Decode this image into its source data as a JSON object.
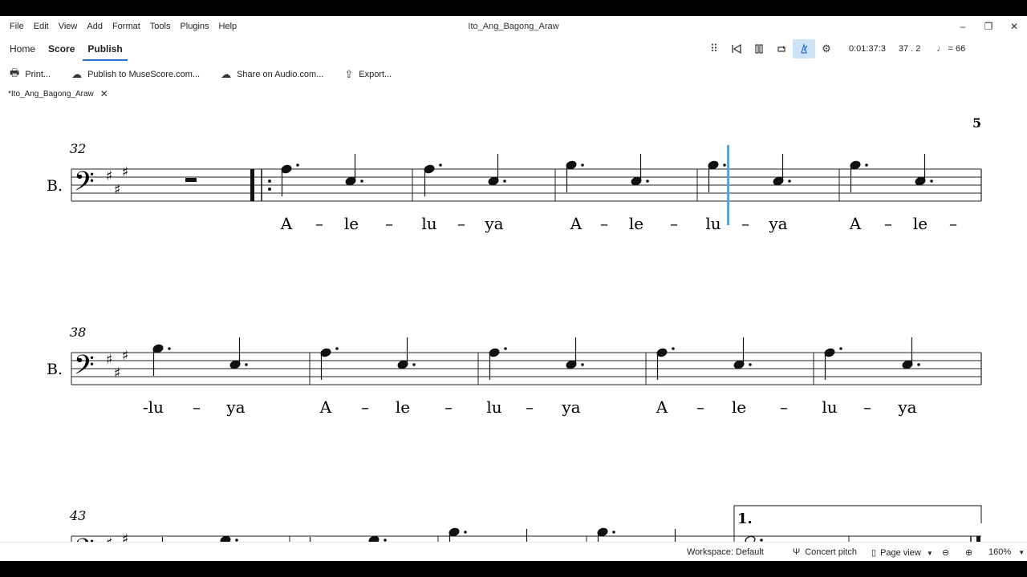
{
  "menu": [
    "File",
    "Edit",
    "View",
    "Add",
    "Format",
    "Tools",
    "Plugins",
    "Help"
  ],
  "window": {
    "title": "Ito_Ang_Bagong_Araw",
    "minimize": "–",
    "restore": "❐",
    "close": "✕"
  },
  "tabs": [
    {
      "label": "Home"
    },
    {
      "label": "Score"
    },
    {
      "label": "Publish"
    }
  ],
  "transport": {
    "time": "0:01:37:3",
    "position": "37 . 2",
    "tempo": "= 66",
    "tempo_note": "♩"
  },
  "toolbar": {
    "print": "Print...",
    "publish": "Publish to MuseScore.com...",
    "share": "Share on Audio.com...",
    "export": "Export..."
  },
  "file_tab": {
    "label": "*Ito_Ang_Bagong_Araw"
  },
  "score": {
    "page_number": "5",
    "instrument": "B.",
    "volta": "1.",
    "systems": [
      {
        "start_measure": "32",
        "lyrics": [
          "A",
          "–",
          "le",
          "–",
          "lu",
          "–",
          "ya",
          "A",
          "–",
          "le",
          "–",
          "lu",
          "–",
          "ya",
          "A",
          "–",
          "le",
          "–"
        ]
      },
      {
        "start_measure": "38",
        "lyrics": [
          "-lu",
          "–",
          "ya",
          "A",
          "–",
          "le",
          "–",
          "lu",
          "–",
          "ya",
          "A",
          "–",
          "le",
          "–",
          "lu",
          "–",
          "ya"
        ]
      },
      {
        "start_measure": "43",
        "lyrics": []
      }
    ]
  },
  "status": {
    "workspace": "Workspace: Default",
    "concert_pitch": "Concert pitch",
    "page_view": "Page view",
    "zoom": "160%"
  }
}
